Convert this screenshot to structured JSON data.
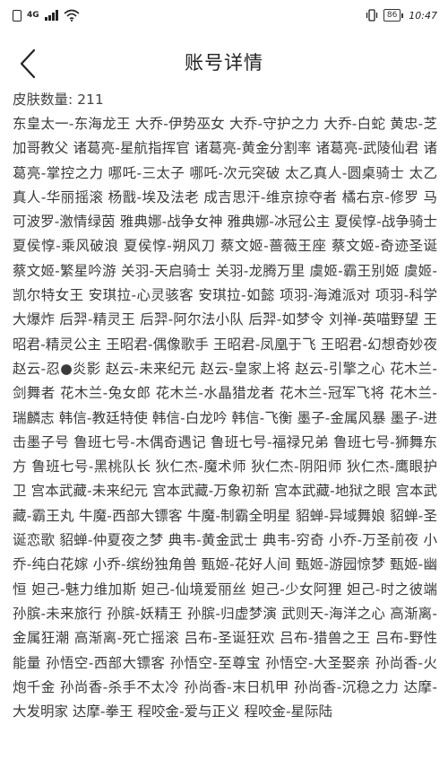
{
  "status_bar": {
    "network": "4G",
    "battery": "86",
    "time": "10:47"
  },
  "header": {
    "title": "账号详情"
  },
  "skins": {
    "count_label": "皮肤数量: 211",
    "list_text": "东皇太一-东海龙王 大乔-伊势巫女 大乔-守护之力 大乔-白蛇 黄忠-芝加哥教父 诸葛亮-星航指挥官 诸葛亮-黄金分割率 诸葛亮-武陵仙君 诸葛亮-掌控之力 哪吒-三太子 哪吒-次元突破 太乙真人-圆桌骑士 太乙真人-华丽摇滚 杨戬-埃及法老 成吉思汗-维京掠夺者 橘右京-修罗 马可波罗-激情绿茵 雅典娜-战争女神 雅典娜-冰冠公主 夏侯惇-战争骑士 夏侯惇-乘风破浪 夏侯惇-朔风刀 蔡文姬-蔷薇王座 蔡文姬-奇迹圣诞 蔡文姬-繁星吟游 关羽-天启骑士 关羽-龙腾万里 虞姬-霸王别姬 虞姬-凯尔特女王 安琪拉-心灵骇客 安琪拉-如懿 项羽-海滩派对 项羽-科学大爆炸 后羿-精灵王 后羿-阿尔法小队 后羿-如梦令 刘禅-英喵野望 王昭君-精灵公主 王昭君-偶像歌手 王昭君-凤凰于飞 王昭君-幻想奇妙夜 赵云-忍●炎影 赵云-未来纪元 赵云-皇家上将 赵云-引擎之心 花木兰-剑舞者 花木兰-兔女郎 花木兰-水晶猎龙者 花木兰-冠军飞将 花木兰-瑞麟志 韩信-教廷特使 韩信-白龙吟 韩信-飞衡 墨子-金属风暴 墨子-进击墨子号 鲁班七号-木偶奇遇记 鲁班七号-福禄兄弟 鲁班七号-狮舞东方 鲁班七号-黑桃队长 狄仁杰-魔术师 狄仁杰-阴阳师 狄仁杰-鹰眼护卫 宫本武藏-未来纪元 宫本武藏-万象初新 宫本武藏-地狱之眼 宫本武藏-霸王丸 牛魔-西部大镖客 牛魔-制霸全明星 貂蝉-异域舞娘 貂蝉-圣诞恋歌 貂蝉-仲夏夜之梦 典韦-黄金武士 典韦-穷奇 小乔-万圣前夜 小乔-纯白花嫁 小乔-缤纷独角兽 甄姬-花好人间 甄姬-游园惊梦 甄姬-幽恒 妲己-魅力维加斯 妲己-仙境爱丽丝 妲己-少女阿狸 妲己-时之彼端 孙膑-未来旅行 孙膑-妖精王 孙膑-归虚梦演 武则天-海洋之心 高渐离-金属狂潮 高渐离-死亡摇滚 吕布-圣诞狂欢 吕布-猎兽之王 吕布-野性能量 孙悟空-西部大镖客 孙悟空-至尊宝 孙悟空-大圣娶亲 孙尚香-火炮千金 孙尚香-杀手不太冷 孙尚香-末日机甲 孙尚香-沉稳之力 达摩-大发明家 达摩-拳王 程咬金-爱与正义 程咬金-星际陆"
  }
}
